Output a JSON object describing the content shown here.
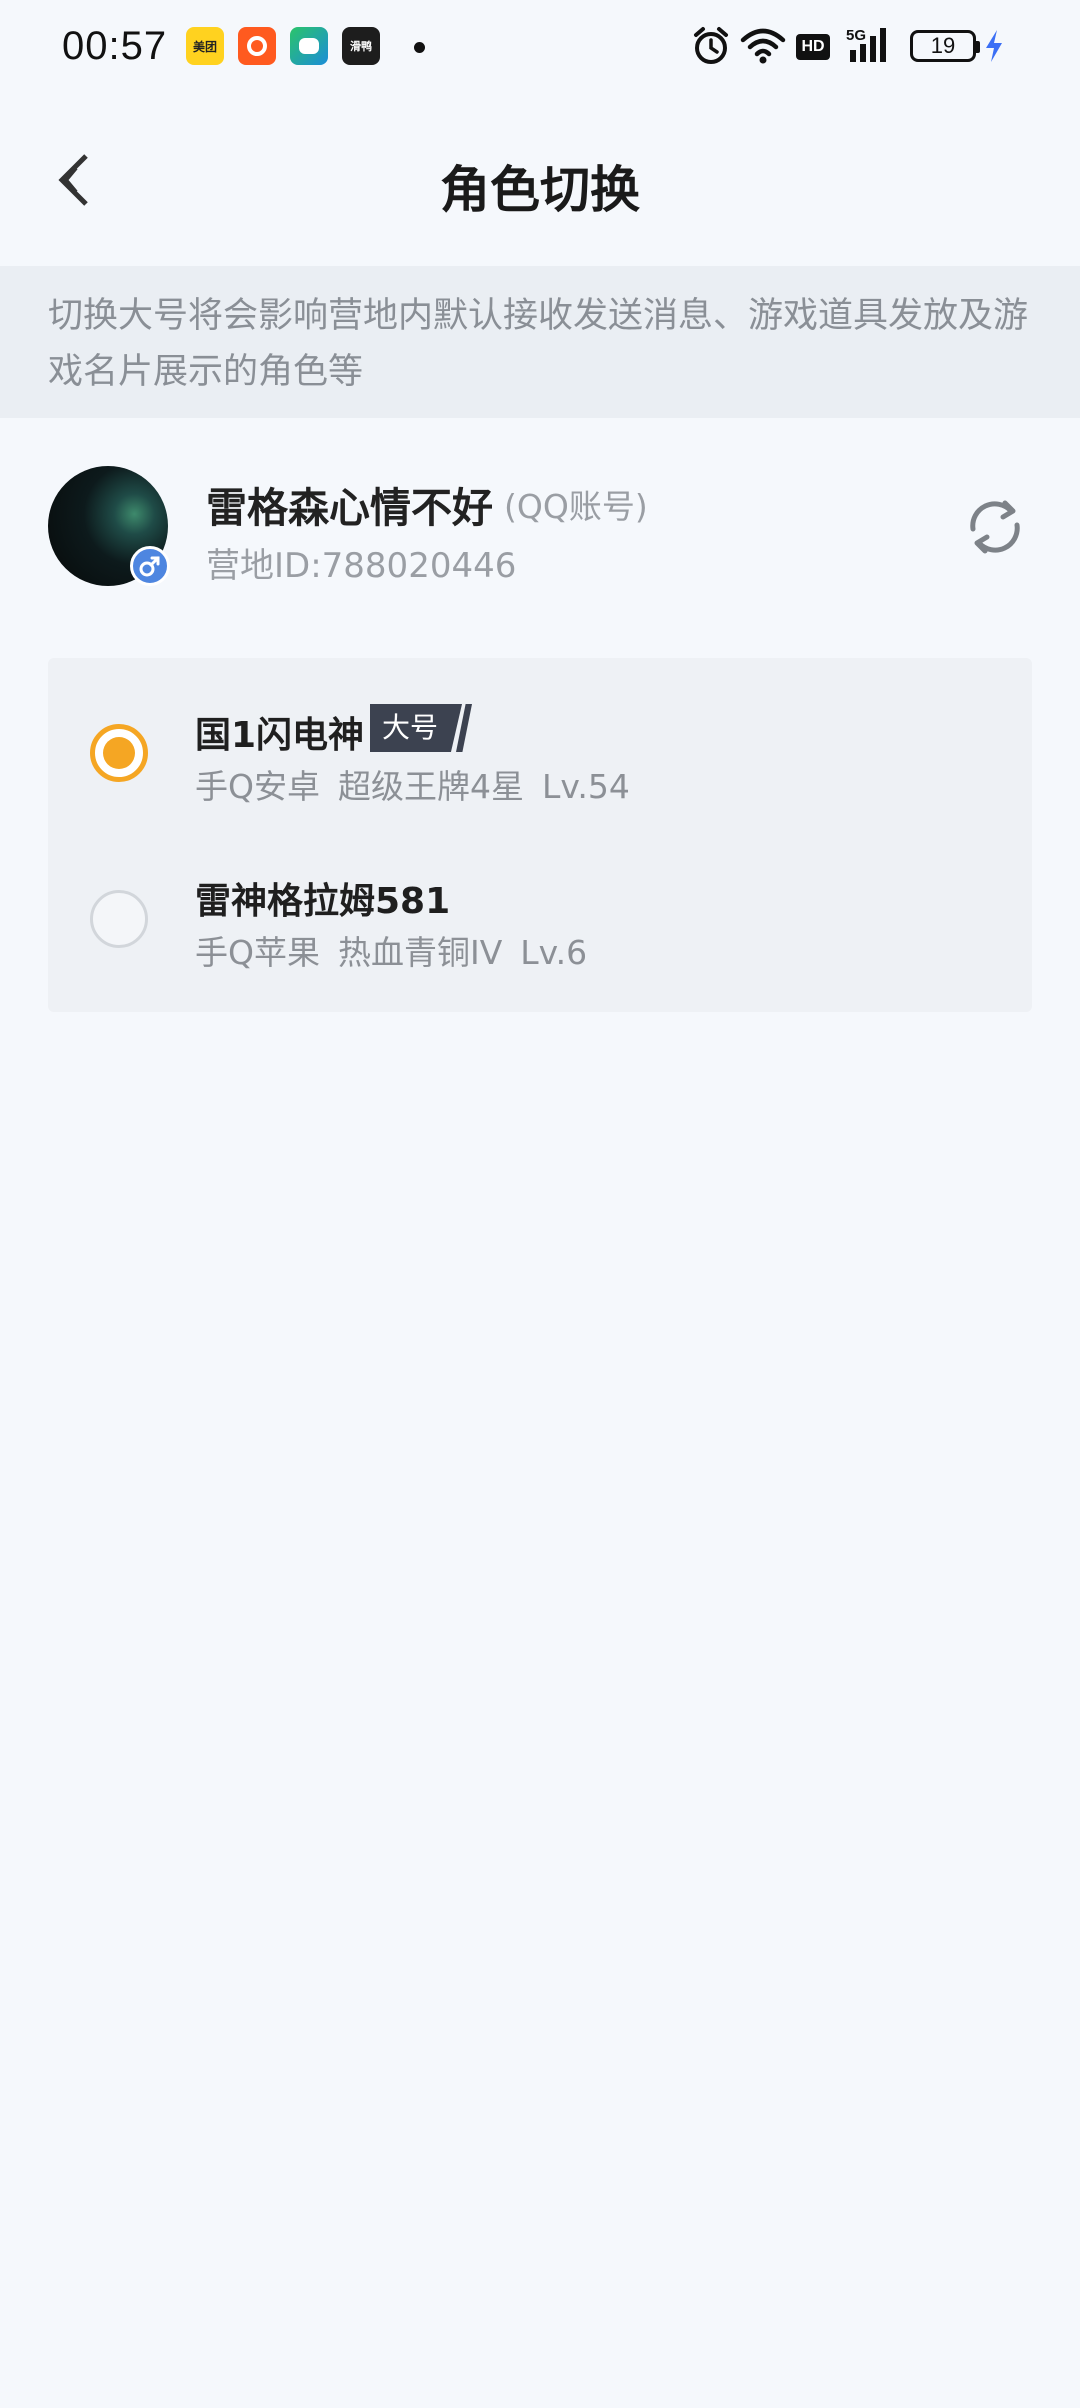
{
  "status_bar": {
    "time": "00:57",
    "app_icons": [
      "美团",
      "快手",
      "AI",
      "滑鸭"
    ],
    "hd_label": "HD",
    "signal_label": "5G",
    "battery_level": "19"
  },
  "header": {
    "title": "角色切换"
  },
  "notice": {
    "text": "切换大号将会影响营地内默认接收发送消息、游戏道具发放及游戏名片展示的角色等"
  },
  "account": {
    "name": "雷格森心情不好",
    "type": "(QQ账号)",
    "camp_id": "营地ID:788020446",
    "gender": "male"
  },
  "roles": [
    {
      "name": "国1闪电神",
      "badge": "大号",
      "selected": true,
      "platform": "手Q安卓",
      "rank": "超级王牌4星",
      "level": "Lv.54"
    },
    {
      "name": "雷神格拉姆581",
      "badge": "",
      "selected": false,
      "platform": "手Q苹果",
      "rank": "热血青铜IV",
      "level": "Lv.6"
    }
  ],
  "colors": {
    "accent": "#f5a623",
    "background": "#f5f8fc",
    "notice_bg": "#eaeef3",
    "list_bg": "#eef1f5",
    "badge_bg": "#3c4250",
    "gender_badge": "#4e86e0"
  }
}
